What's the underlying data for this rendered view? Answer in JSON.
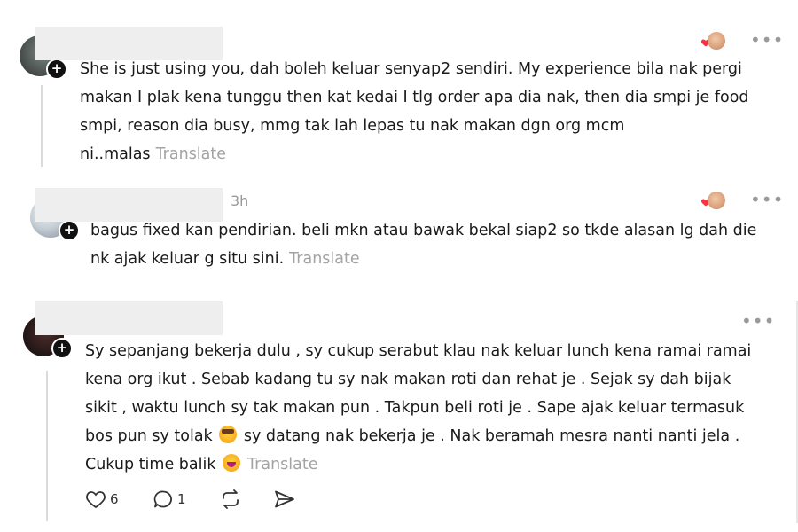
{
  "comments": [
    {
      "text": "She is just using you, dah boleh keluar senyap2 sendiri. My experience bila nak pergi makan I plak kena tunggu then kat kedai I tlg order apa dia nak, then dia smpi je food smpi, reason dia busy, mmg tak lah lepas tu nak makan dgn org mcm ni..malas",
      "translate": "Translate",
      "more": "•••"
    },
    {
      "timestamp": "3h",
      "text": "bagus fixed kan pendirian. beli mkn atau bawak bekal siap2 so tkde alasan lg dah die nk ajak keluar g situ sini.",
      "translate": "Translate",
      "more": "•••"
    },
    {
      "text_part1": "Sy sepanjang bekerja dulu , sy cukup serabut klau nak keluar lunch kena ramai ramai kena org ikut . Sebab kadang tu sy nak makan roti dan rehat je . Sejak sy dah bijak sikit , waktu lunch sy tak makan pun . Takpun beli roti je . Sape ajak keluar termasuk bos pun sy tolak",
      "text_part2": "sy datang nak bekerja je . Nak beramah mesra nanti nanti jela . Cukup time balik",
      "translate": "Translate",
      "more": "•••",
      "like_count": "6",
      "reply_count": "1"
    }
  ],
  "icons": {
    "follow": "plus-icon",
    "like": "heart-icon",
    "reply": "comment-icon",
    "repost": "repost-icon",
    "share": "send-icon",
    "more": "more-horizontal-icon"
  },
  "colors": {
    "heart": "#ff3040",
    "translate": "#a3a3a3",
    "timestamp": "#9a9a9a"
  }
}
